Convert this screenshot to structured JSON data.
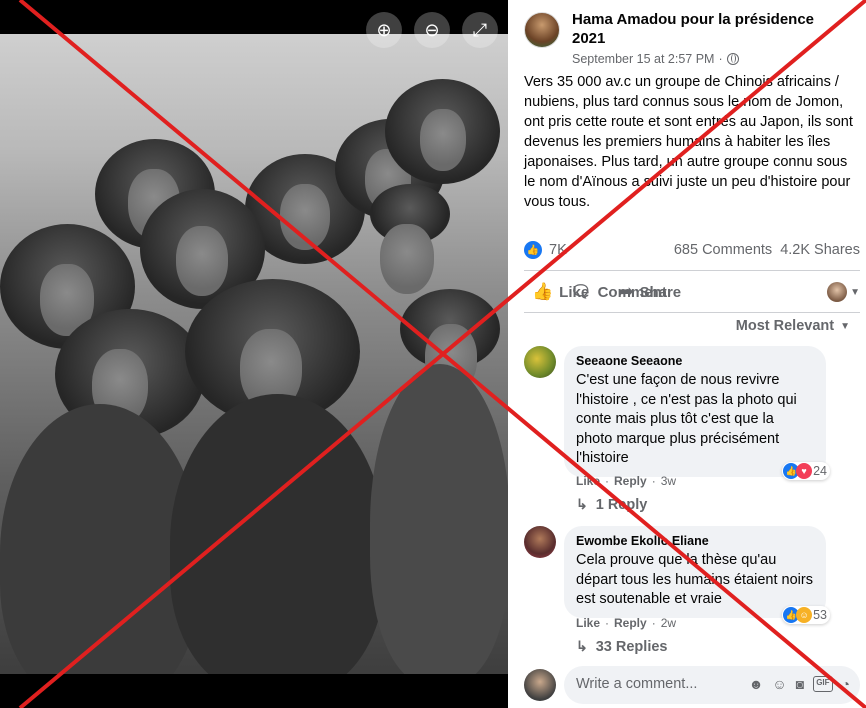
{
  "viewer": {
    "zoom_in_icon": "⊕",
    "zoom_out_icon": "⊖",
    "fullscreen_icon": "⤢"
  },
  "post": {
    "page_name": "Hama Amadou pour la présidence 2021",
    "timestamp": "September 15 at 2:57 PM",
    "separator": "·",
    "text": "Vers 35 000 av.c un groupe de Chinois africains / nubiens, plus tard connus sous le nom de Jomon, ont pris cette route et sont entrés au Japon, ils sont devenus les premiers humains à habiter les îles japonaises. Plus tard, un autre groupe connu sous le nom d'Aïnous a suivi juste un peu d'histoire pour vous tous.",
    "reactions_count": "7K",
    "comments_count": "685 Comments",
    "shares_count": "4.2K Shares"
  },
  "actions": {
    "like": "Like",
    "comment": "Comment",
    "share": "Share"
  },
  "sort": {
    "label": "Most Relevant"
  },
  "comments": [
    {
      "author": "Seeaone Seeaone",
      "text": "C'est une façon de nous revivre l'histoire , ce n'est pas la photo qui conte mais plus tôt c'est que la photo marque plus précisément l'histoire",
      "like_label": "Like",
      "reply_label": "Reply",
      "age": "3w",
      "reactions": "24",
      "replies": "1 Reply"
    },
    {
      "author": "Ewombe Ekollo Eliane",
      "text": "Cela prouve que la thèse qu'au départ tous les humains étaient noirs est soutenable et vraie",
      "like_label": "Like",
      "reply_label": "Reply",
      "age": "2w",
      "reactions": "53",
      "replies": "33 Replies"
    }
  ],
  "write_comment": {
    "placeholder": "Write a comment..."
  },
  "colors": {
    "facebook_blue": "#1877f2",
    "overlay_red": "#e0201f",
    "secondary_text": "#65676b"
  }
}
